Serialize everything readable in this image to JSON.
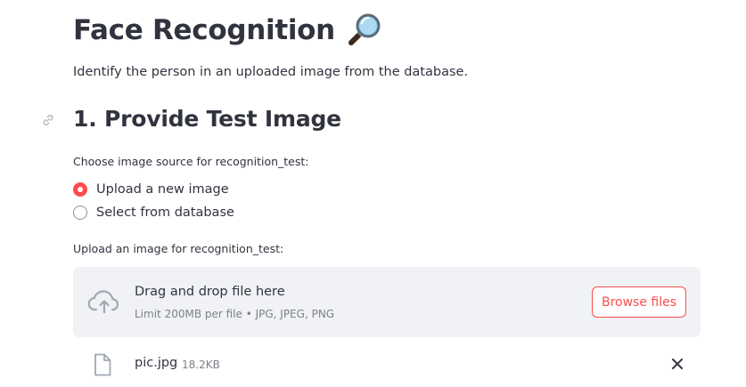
{
  "header": {
    "title": "Face Recognition",
    "title_icon": "magnifying-glass-emoji",
    "subtitle": "Identify the person in an uploaded image from the database."
  },
  "section": {
    "heading": "1. Provide Test Image",
    "anchor_icon": "link-icon"
  },
  "source_radio": {
    "label": "Choose image source for recognition_test:",
    "options": [
      {
        "label": "Upload a new image",
        "selected": true
      },
      {
        "label": "Select from database",
        "selected": false
      }
    ]
  },
  "uploader": {
    "label": "Upload an image for recognition_test:",
    "drop_text": "Drag and drop file here",
    "limit_text": "Limit 200MB per file • JPG, JPEG, PNG",
    "browse_label": "Browse files",
    "icon": "cloud-upload-icon"
  },
  "uploaded_file": {
    "name": "pic.jpg",
    "size": "18.2KB",
    "icon": "file-icon",
    "remove_icon": "close-icon"
  },
  "colors": {
    "accent": "#ff4b4b",
    "text": "#31333f",
    "muted": "#7e8088",
    "dropzone_bg": "#f0f2f6"
  }
}
